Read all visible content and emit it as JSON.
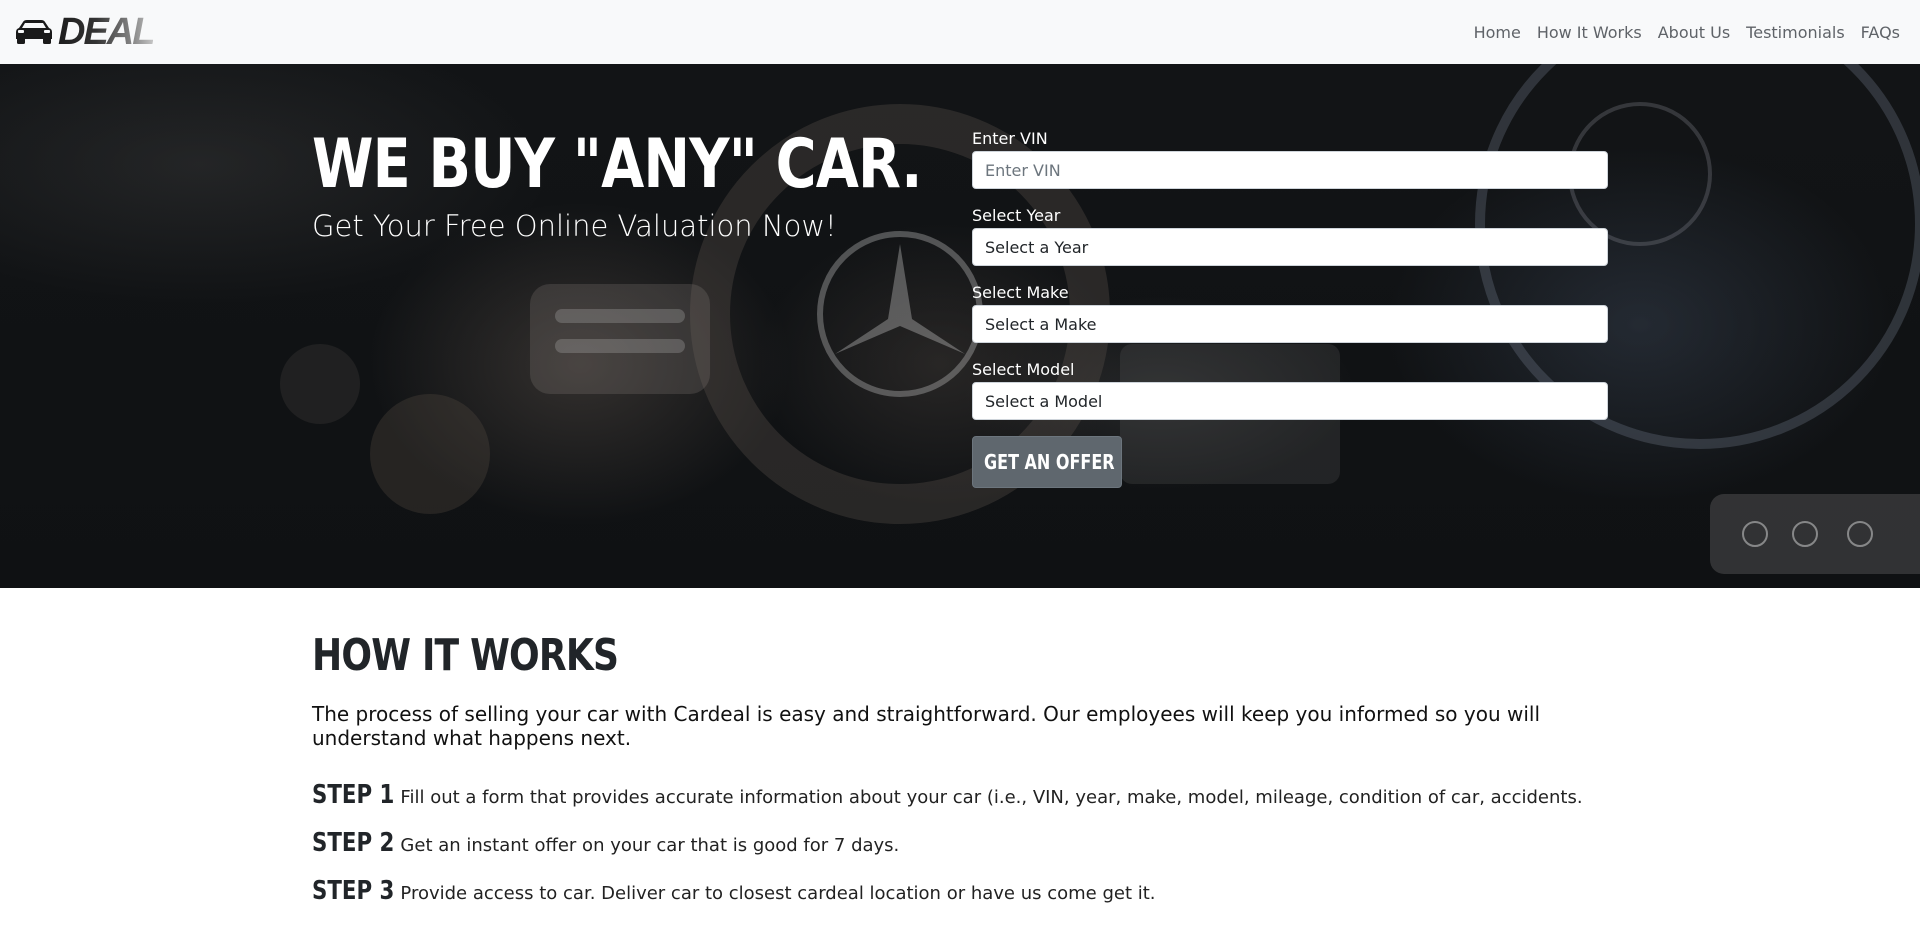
{
  "navbar": {
    "brand": "DEAL",
    "links": [
      "Home",
      "How It Works",
      "About Us",
      "Testimonials",
      "FAQs"
    ]
  },
  "hero": {
    "title": "WE BUY \"ANY\" CAR.",
    "subtitle": "Get Your Free Online Valuation Now!",
    "form": {
      "vin_label": "Enter VIN",
      "vin_placeholder": "Enter VIN",
      "year_label": "Select Year",
      "year_value": "Select a Year",
      "make_label": "Select Make",
      "make_value": "Select a Make",
      "model_label": "Select Model",
      "model_value": "Select a Model",
      "submit_label": "GET AN OFFER"
    }
  },
  "how": {
    "title": "HOW IT WORKS",
    "intro": "The process of selling your car with Cardeal is easy and straightforward. Our employees will keep you informed so you will understand what happens next.",
    "steps": [
      {
        "label": "STEP 1",
        "text": "Fill out a form that provides accurate information about your car (i.e., VIN, year, make, model, mileage, condition of car, accidents."
      },
      {
        "label": "STEP 2",
        "text": "Get an instant offer on your car that is good for 7 days."
      },
      {
        "label": "STEP 3",
        "text": "Provide access to car. Deliver car to closest cardeal location or have us come get it."
      }
    ]
  },
  "colors": {
    "navbar_bg": "#f8f9fa",
    "hero_bg": "#121416",
    "button_bg": "#5f676e",
    "text_dark": "#212529"
  }
}
